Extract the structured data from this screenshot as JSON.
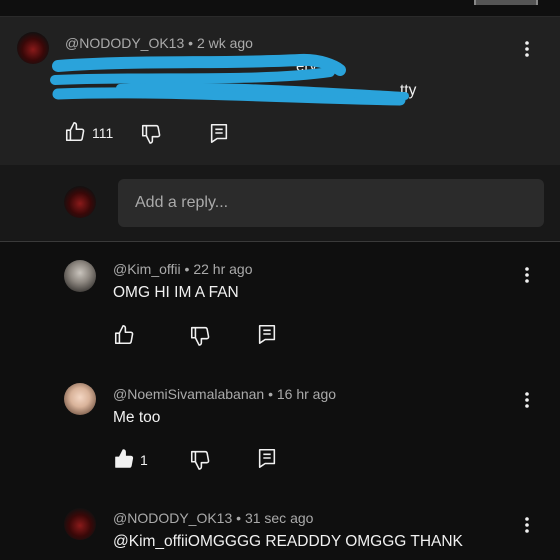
{
  "parent_comment": {
    "author": "@NODODY_OK13",
    "time": "2 wk ago",
    "text_line1_visible": "ery",
    "text_line2_visible": "tty",
    "likes": "111"
  },
  "reply_box": {
    "placeholder": "Add a reply..."
  },
  "replies": [
    {
      "author": "@Kim_offii",
      "time": "22 hr ago",
      "text": "OMG HI IM A FAN",
      "likes": ""
    },
    {
      "author": "@NoemiSivamalabanan",
      "time": "16 hr ago",
      "text": "Me too",
      "likes": "1"
    },
    {
      "author": "@NODODY_OK13",
      "time": "31 sec ago",
      "text": "@Kim_offiiOMGGGG READDDY OMGGG THANK"
    }
  ],
  "separator": "•",
  "icons": {
    "like": "thumbs-up-icon",
    "liked": "thumbs-up-filled-icon",
    "dislike": "thumbs-down-icon",
    "reply": "comment-icon",
    "more": "kebab-menu-icon"
  },
  "colors": {
    "redaction": "#2aa3db",
    "background": "#0f0f0f",
    "parent_bg": "#212121",
    "reply_bg": "#181818"
  }
}
